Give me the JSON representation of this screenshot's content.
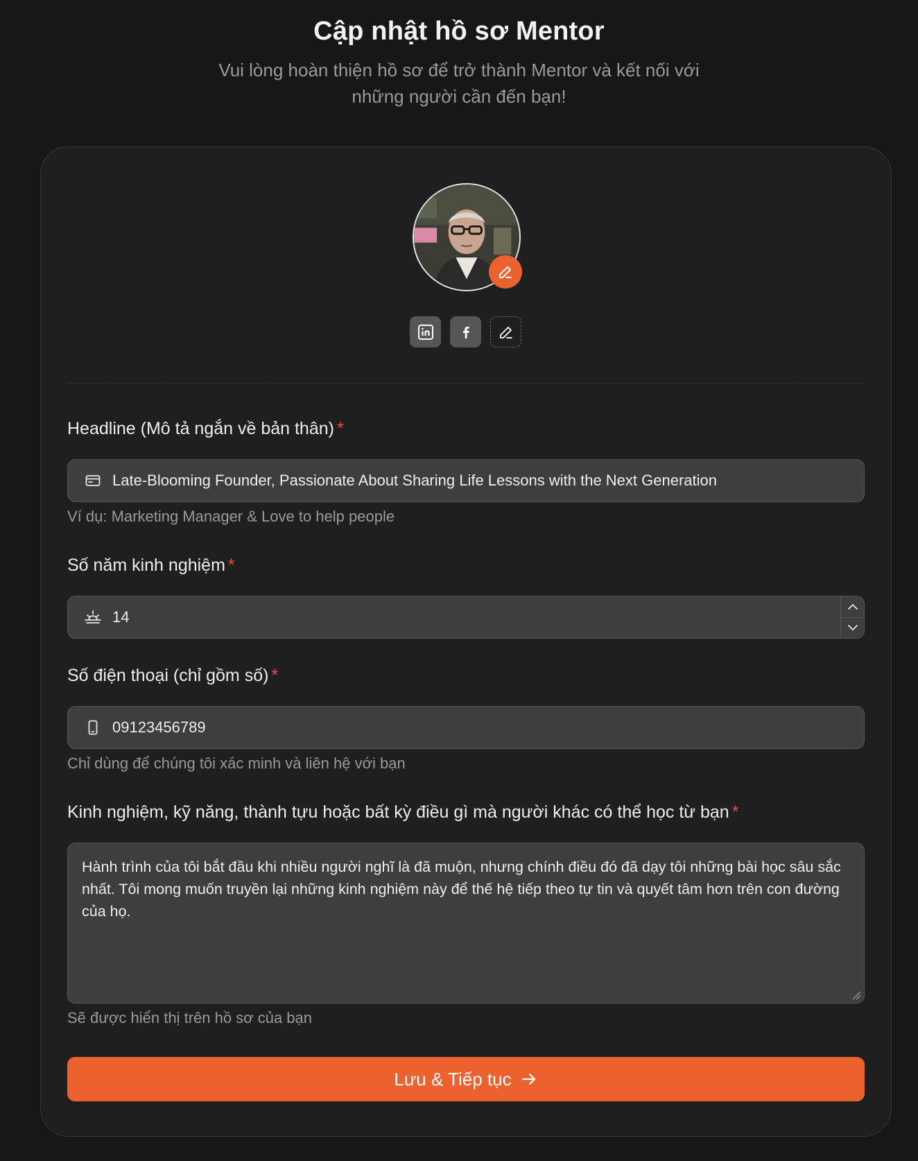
{
  "header": {
    "title": "Cập nhật hồ sơ Mentor",
    "subtitle": "Vui lòng hoàn thiện hồ sơ để trở thành Mentor và kết nối với những người cần đến bạn!"
  },
  "profile": {
    "avatar_icon": "user-photo",
    "edit_icon": "pencil-icon",
    "socials": [
      {
        "name": "linkedin",
        "icon": "linkedin-icon"
      },
      {
        "name": "facebook",
        "icon": "facebook-icon"
      },
      {
        "name": "add-link",
        "icon": "pencil-icon"
      }
    ]
  },
  "fields": {
    "headline": {
      "label": "Headline (Mô tả ngắn về bản thân)",
      "required_mark": "*",
      "value": "Late-Blooming Founder, Passionate About Sharing Life Lessons with the Next Generation",
      "helper": "Ví dụ: Marketing Manager & Love to help people",
      "icon": "id-card-icon"
    },
    "experience": {
      "label": "Số năm kinh nghiệm",
      "required_mark": "*",
      "value": "14",
      "icon": "sunrise-icon"
    },
    "phone": {
      "label": "Số điện thoại (chỉ gồm số)",
      "required_mark": "*",
      "value": "09123456789",
      "helper": "Chỉ dùng để chúng tôi xác minh và liên hệ với bạn",
      "icon": "phone-icon"
    },
    "bio": {
      "label": "Kinh nghiệm, kỹ năng, thành tựu hoặc bất kỳ điều gì mà người khác có thể học từ bạn",
      "required_mark": "*",
      "value": "Hành trình của tôi bắt đầu khi nhiều người nghĩ là đã muộn, nhưng chính điều đó đã dạy tôi những bài học sâu sắc nhất. Tôi mong muốn truyền lại những kinh nghiệm này để thế hệ tiếp theo tự tin và quyết tâm hơn trên con đường của họ.",
      "helper": "Sẽ được hiển thị trên hồ sơ của bạn"
    }
  },
  "actions": {
    "submit_label": "Lưu & Tiếp tục"
  },
  "colors": {
    "background": "#171717",
    "card": "#1f1f1f",
    "accent": "#eb622f",
    "required": "#f0483e"
  }
}
